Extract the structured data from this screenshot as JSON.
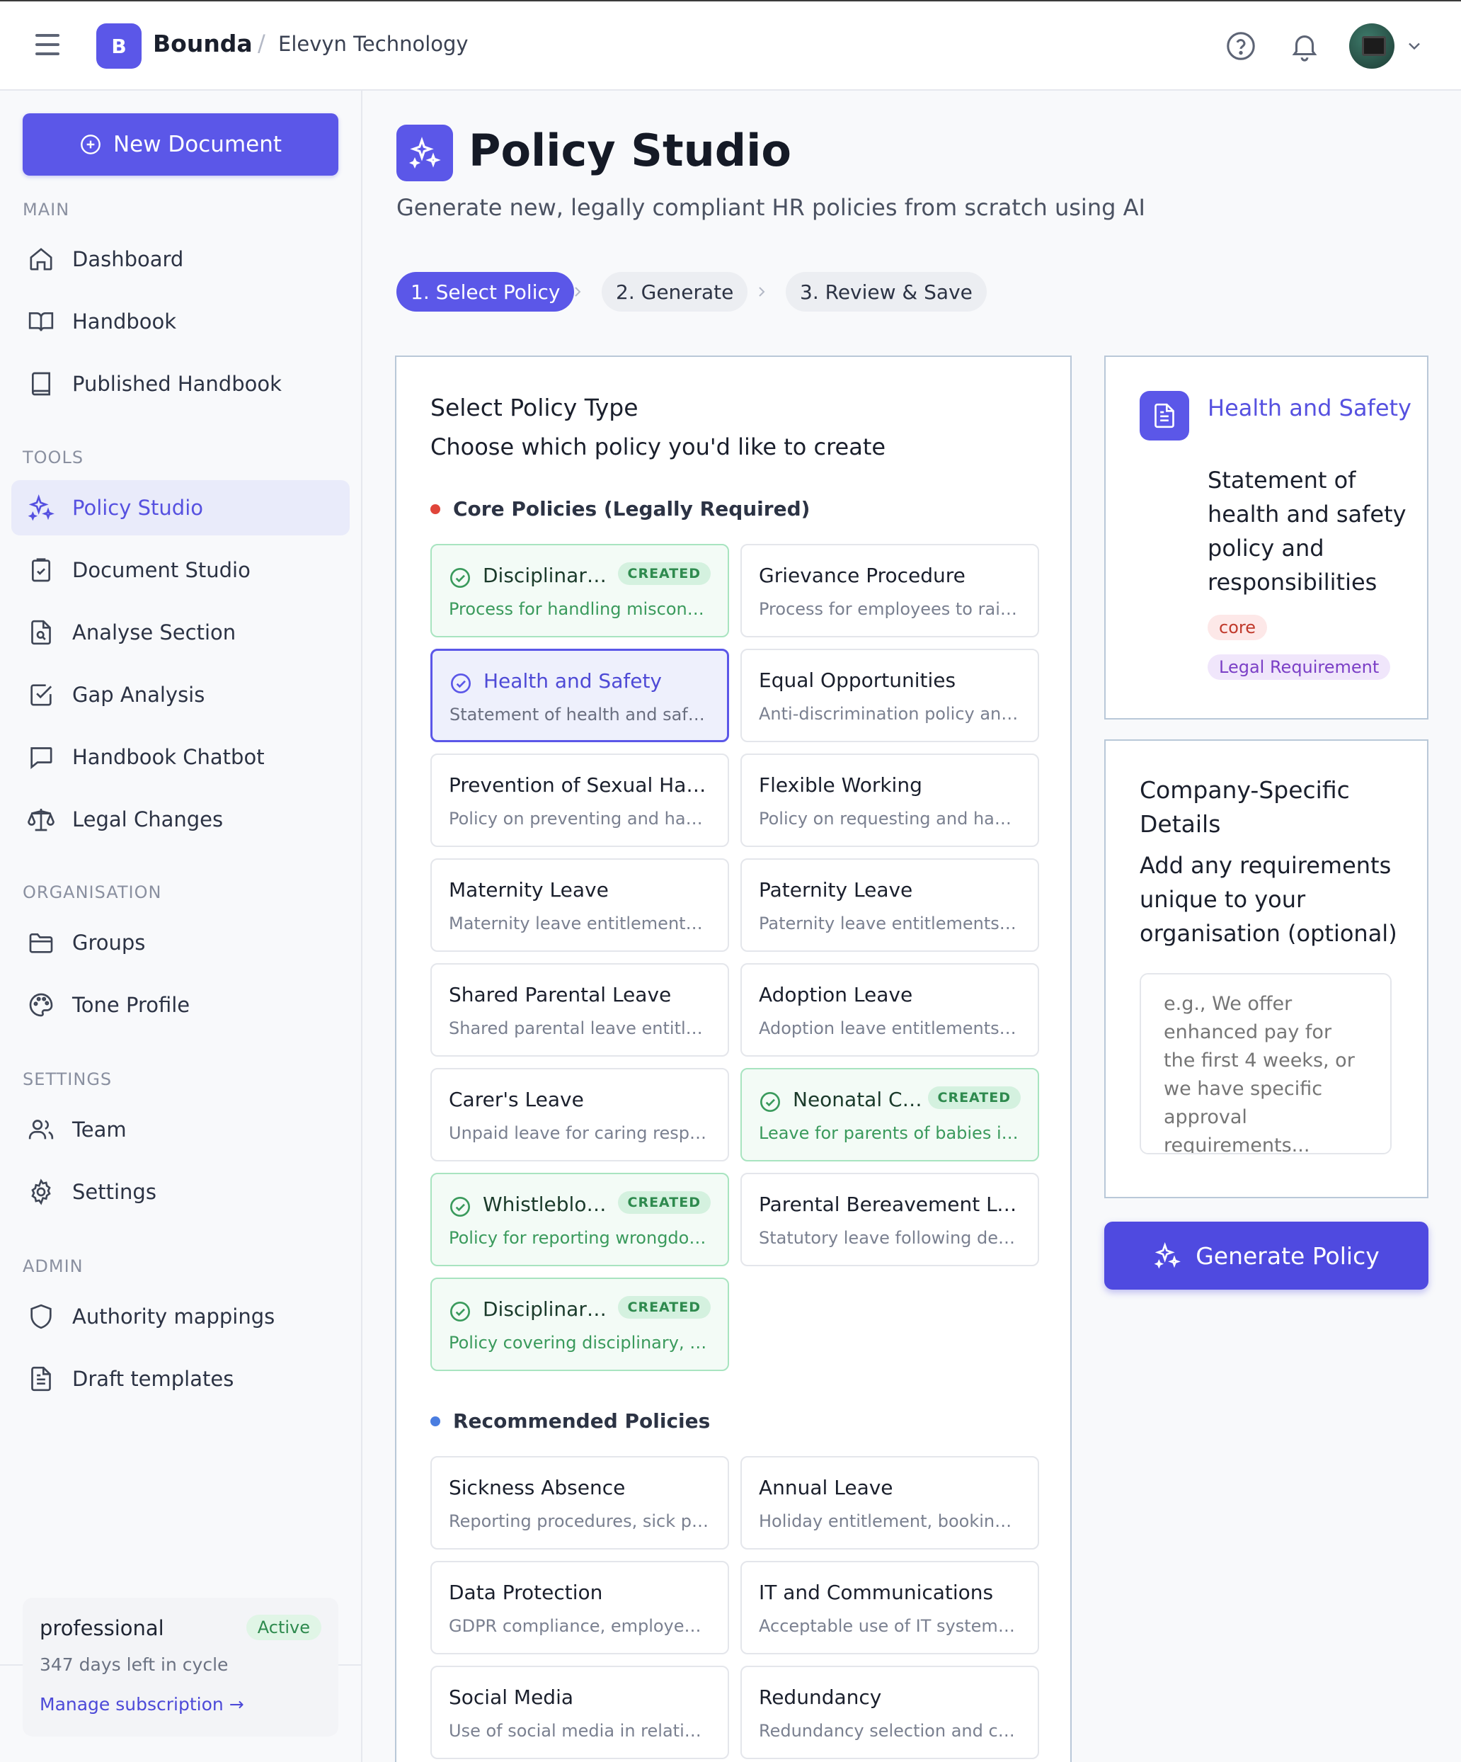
{
  "header": {
    "logo_letter": "B",
    "brand": "Bounda",
    "separator": "/",
    "organisation": "Elevyn Technology"
  },
  "sidebar": {
    "new_document": "New Document",
    "sections": {
      "main": "MAIN",
      "tools": "TOOLS",
      "organisation": "ORGANISATION",
      "settings": "SETTINGS",
      "admin": "ADMIN"
    },
    "items": [
      {
        "label": "Dashboard",
        "icon": "home-icon"
      },
      {
        "label": "Handbook",
        "icon": "book-open-icon"
      },
      {
        "label": "Published Handbook",
        "icon": "book-icon"
      },
      {
        "label": "Policy Studio",
        "icon": "sparkles-icon",
        "active": true
      },
      {
        "label": "Document Studio",
        "icon": "clipboard-icon"
      },
      {
        "label": "Analyse Section",
        "icon": "file-search-icon"
      },
      {
        "label": "Gap Analysis",
        "icon": "checkbox-icon"
      },
      {
        "label": "Handbook Chatbot",
        "icon": "chat-icon"
      },
      {
        "label": "Legal Changes",
        "icon": "scale-icon"
      },
      {
        "label": "Groups",
        "icon": "folder-icon"
      },
      {
        "label": "Tone Profile",
        "icon": "palette-icon"
      },
      {
        "label": "Team",
        "icon": "users-icon"
      },
      {
        "label": "Settings",
        "icon": "gear-icon"
      },
      {
        "label": "Authority mappings",
        "icon": "shield-icon"
      },
      {
        "label": "Draft templates",
        "icon": "document-icon"
      }
    ],
    "plan": {
      "name": "professional",
      "status": "Active",
      "days_left": "347 days left in cycle",
      "manage_link": "Manage subscription →"
    }
  },
  "page": {
    "title": "Policy Studio",
    "subtitle": "Generate new, legally compliant HR policies from scratch using AI",
    "steps": [
      "1. Select Policy",
      "2. Generate",
      "3. Review & Save"
    ],
    "active_step": 0
  },
  "selector": {
    "title": "Select Policy Type",
    "subtitle": "Choose which policy you'd like to create",
    "created_badge": "CREATED",
    "core_heading": "Core Policies (Legally Required)",
    "recommended_heading": "Recommended Policies",
    "core": [
      {
        "title": "Disciplinary Procedure",
        "desc": "Process for handling misconduct",
        "status": "created"
      },
      {
        "title": "Grievance Procedure",
        "desc": "Process for employees to raise concerns",
        "status": "none"
      },
      {
        "title": "Health and Safety",
        "desc": "Statement of health and safety policy and responsibilities",
        "status": "selected"
      },
      {
        "title": "Equal Opportunities",
        "desc": "Anti-discrimination policy and commitments",
        "status": "none"
      },
      {
        "title": "Prevention of Sexual Harassment",
        "desc": "Policy on preventing and handling harassment",
        "status": "none"
      },
      {
        "title": "Flexible Working",
        "desc": "Policy on requesting and handling flexible working",
        "status": "none"
      },
      {
        "title": "Maternity Leave",
        "desc": "Maternity leave entitlements and procedures",
        "status": "none"
      },
      {
        "title": "Paternity Leave",
        "desc": "Paternity leave entitlements and procedures",
        "status": "none"
      },
      {
        "title": "Shared Parental Leave",
        "desc": "Shared parental leave entitlements",
        "status": "none"
      },
      {
        "title": "Adoption Leave",
        "desc": "Adoption leave entitlements and procedures",
        "status": "none"
      },
      {
        "title": "Carer's Leave",
        "desc": "Unpaid leave for caring responsibilities",
        "status": "none"
      },
      {
        "title": "Neonatal Care Leave",
        "desc": "Leave for parents of babies in neonatal care",
        "status": "created"
      },
      {
        "title": "Whistleblowing",
        "desc": "Policy for reporting wrongdoing",
        "status": "created"
      },
      {
        "title": "Parental Bereavement Leave",
        "desc": "Statutory leave following death of a child",
        "status": "none"
      },
      {
        "title": "Disciplinary, Dismissal and Appeals",
        "desc": "Policy covering disciplinary, dismissal and appeals",
        "status": "created"
      }
    ],
    "recommended": [
      {
        "title": "Sickness Absence",
        "desc": "Reporting procedures, sick pay, return to work"
      },
      {
        "title": "Annual Leave",
        "desc": "Holiday entitlement, booking, carry over"
      },
      {
        "title": "Data Protection",
        "desc": "GDPR compliance, employee data handling"
      },
      {
        "title": "IT and Communications",
        "desc": "Acceptable use of IT systems, email and internet"
      },
      {
        "title": "Social Media",
        "desc": "Use of social media in relation to work"
      },
      {
        "title": "Redundancy",
        "desc": "Redundancy selection and consultation"
      }
    ]
  },
  "detail": {
    "title": "Health and Safety",
    "description": "Statement of health and safety policy and responsibilities",
    "tags": [
      "core",
      "Legal Requirement"
    ]
  },
  "company_details": {
    "title": "Company-Specific Details",
    "subtitle": "Add any requirements unique to your organisation (optional)",
    "placeholder": "e.g., We offer enhanced pay for the first 4 weeks, or we have specific approval requirements...",
    "value": ""
  },
  "generate_button": "Generate Policy",
  "colors": {
    "accent": "#5b57e8",
    "created": "#2e8a4e",
    "core_dot": "#e0453a",
    "recommended_dot": "#4a7de0"
  }
}
